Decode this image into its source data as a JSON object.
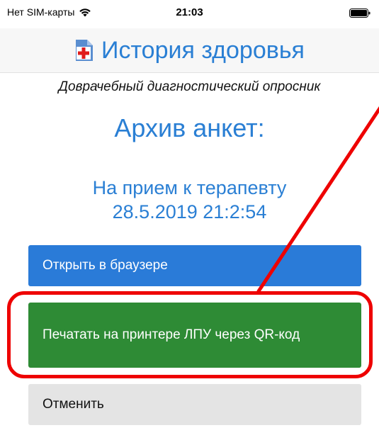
{
  "status_bar": {
    "carrier": "Нет SIM-карты",
    "time": "21:03",
    "wifi_icon": "wifi-icon",
    "battery_icon": "battery-icon"
  },
  "header": {
    "logo_icon": "medical-cross-icon",
    "title": "История здоровья"
  },
  "subtitle": "Доврачебный диагностический опросник",
  "archive_title": "Архив анкет:",
  "survey": {
    "name": "На прием к терапевту",
    "date": "28.5.2019 21:2:54"
  },
  "buttons": {
    "open_browser": "Открыть в браузере",
    "print_qr": "Печатать на принтере ЛПУ через QR-код",
    "cancel": "Отменить"
  },
  "colors": {
    "accent_blue": "#2a7fd4",
    "button_blue": "#2a7bd8",
    "button_green": "#2e8b35",
    "button_gray": "#e4e4e4",
    "annotation_red": "#ee0000"
  }
}
